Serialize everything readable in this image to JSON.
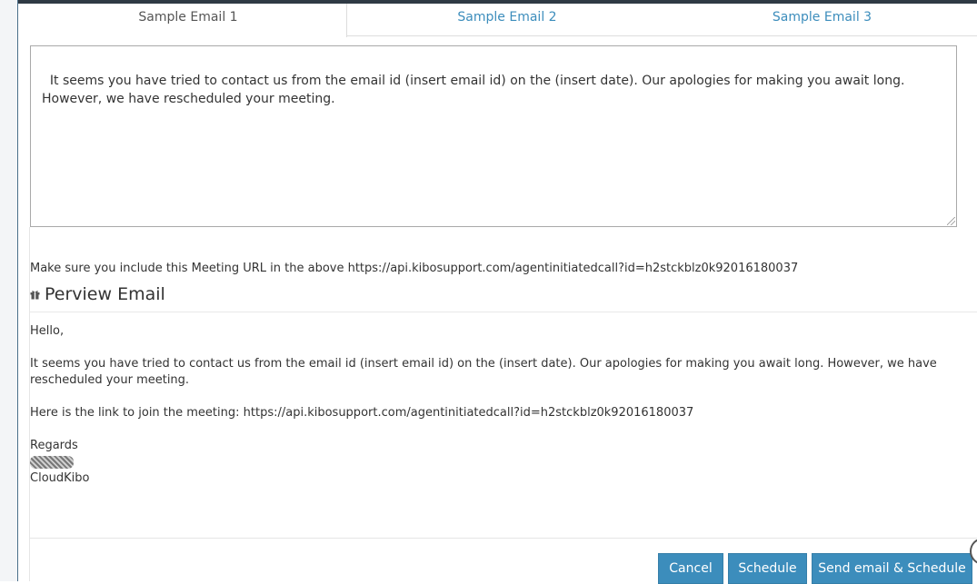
{
  "tabs": [
    {
      "label": "Sample Email 1",
      "active": true
    },
    {
      "label": "Sample Email 2",
      "active": false
    },
    {
      "label": "Sample Email 3",
      "active": false
    }
  ],
  "editor": {
    "value": "It seems you have tried to contact us from the email id (insert email id) on the (insert date). Our apologies for making you await long.\nHowever, we have rescheduled your meeting."
  },
  "hint": "Make sure you include this Meeting URL in the above https://api.kibosupport.com/agentinitiatedcall?id=h2stckblz0k92016180037",
  "preview": {
    "icon": "gift-icon",
    "title": "Perview Email",
    "greeting": "Hello,",
    "body": "It seems you have tried to contact us from the email id (insert email id) on the (insert date). Our apologies for making you await long. However, we have rescheduled your meeting.",
    "link_line": "Here is the link to join the meeting: https://api.kibosupport.com/agentinitiatedcall?id=h2stckblz0k92016180037",
    "regards": "Regards",
    "company": "CloudKibo"
  },
  "buttons": {
    "cancel": "Cancel",
    "schedule": "Schedule",
    "send": "Send email & Schedule"
  },
  "colors": {
    "accent": "#3c8dbc",
    "topbar": "#2f3a44"
  }
}
